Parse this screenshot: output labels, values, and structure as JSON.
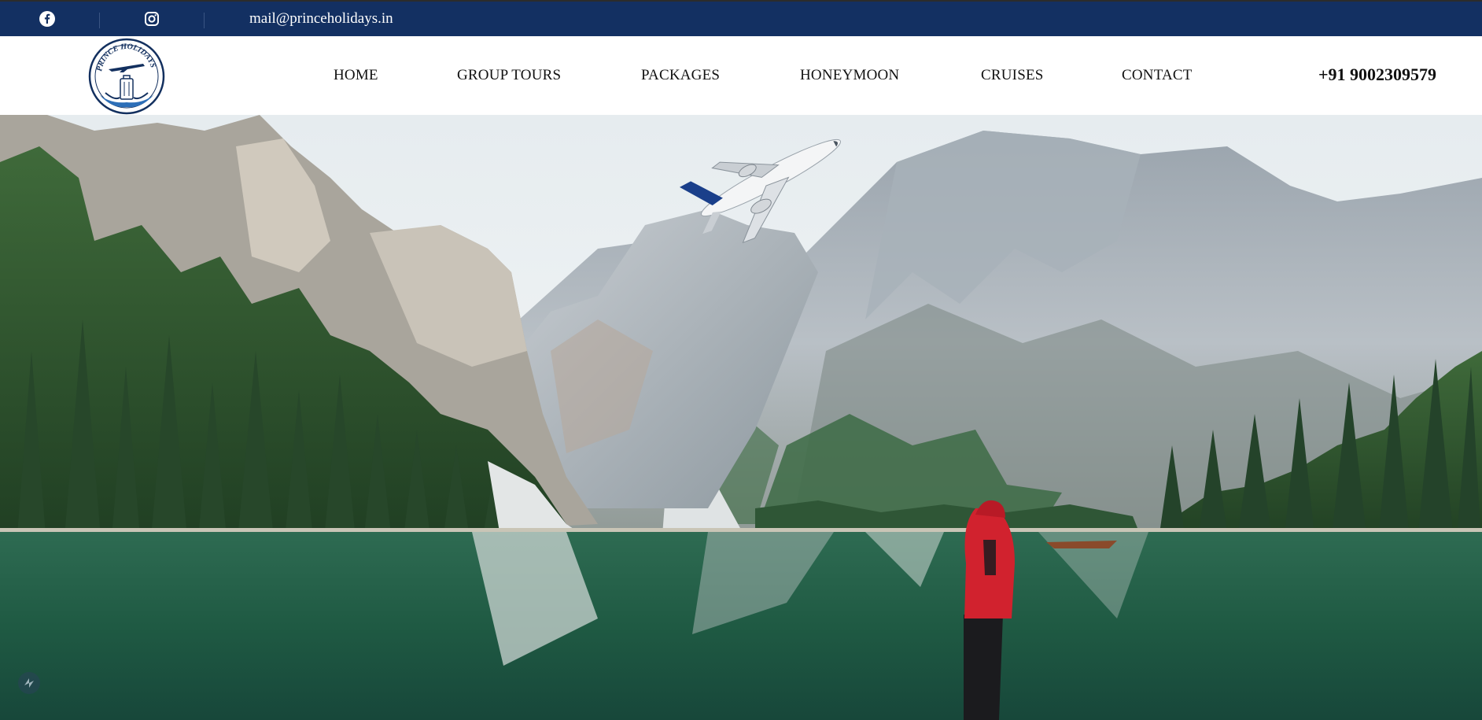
{
  "topbar": {
    "email": "mail@princeholidays.in",
    "icons": [
      "facebook-icon",
      "instagram-icon"
    ]
  },
  "brand": {
    "logo_text": "PRINCE HOLIDAYS"
  },
  "nav": {
    "items": [
      {
        "label": "HOME"
      },
      {
        "label": "GROUP TOURS"
      },
      {
        "label": "PACKAGES"
      },
      {
        "label": "HONEYMOON"
      },
      {
        "label": "CRUISES"
      },
      {
        "label": "CONTACT"
      }
    ]
  },
  "contact": {
    "phone": "+91 9002309579"
  },
  "colors": {
    "topbar": "#133062",
    "text": "#111111",
    "accent_red": "#d1222e"
  }
}
